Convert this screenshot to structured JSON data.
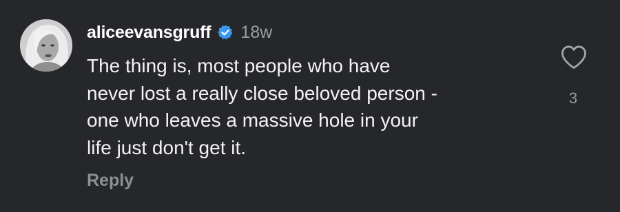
{
  "comment": {
    "username": "aliceevansgruff",
    "timestamp": "18w",
    "verified_icon": "verified-badge-icon",
    "text_lines": [
      "The thing is, most people who have",
      "never lost a really close beloved person -",
      "one who leaves a massive hole in your",
      "life just don't get it."
    ],
    "reply_label": "Reply",
    "like_icon": "heart-icon",
    "like_count": "3"
  },
  "colors": {
    "background": "#26272b",
    "text": "#f3f3f5",
    "muted": "#9b9ca1",
    "verified": "#3897f0"
  }
}
